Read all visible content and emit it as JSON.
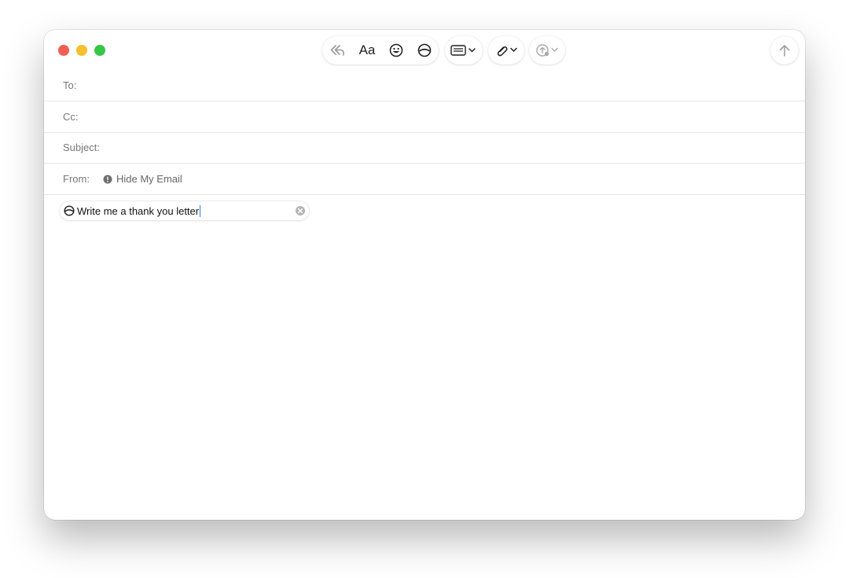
{
  "window": {
    "traffic_lights": {
      "close": "#ee5e57",
      "minimize": "#f5bf2e",
      "zoom": "#36c748"
    }
  },
  "toolbar": {
    "reply_icon": "reply-arrow-icon",
    "format_label": "Aa",
    "emoji_icon": "smiley-icon",
    "writing_tools_icon": "writing-tools-icon",
    "header_fields_icon": "header-fields-icon",
    "attachment_icon": "paperclip-icon",
    "upload_icon": "cloud-upload-icon",
    "send_icon": "arrow-up-icon"
  },
  "compose": {
    "to_label": "To:",
    "to_value": "",
    "cc_label": "Cc:",
    "cc_value": "",
    "subject_label": "Subject:",
    "subject_value": "",
    "from_label": "From:",
    "from_value": "Hide My Email"
  },
  "writing_prompt": {
    "text": "Write me a thank you letter"
  },
  "colors": {
    "caret": "#2f7de1",
    "label_text": "#777777"
  }
}
